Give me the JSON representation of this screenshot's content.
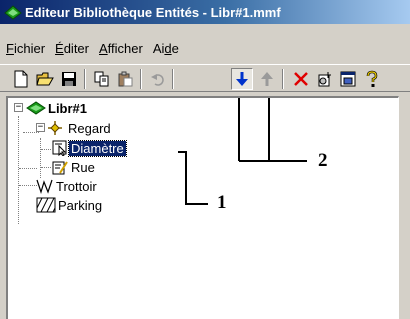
{
  "window": {
    "title": "Editeur Bibliothèque Entités - Libr#1.mmf"
  },
  "menu": [
    {
      "underline": "F",
      "rest": "ichier"
    },
    {
      "underline": "É",
      "rest": "diter"
    },
    {
      "underline": "A",
      "rest": "fficher"
    },
    {
      "pre": "Ai",
      "underline": "d",
      "rest": "e"
    }
  ],
  "toolbar": {
    "buttons": [
      "new-icon",
      "open-icon",
      "save-icon",
      "copy-icon",
      "paste-icon",
      "undo-icon",
      "move-down-icon",
      "move-up-icon",
      "delete-icon",
      "add-node-icon",
      "properties-icon",
      "help-icon"
    ],
    "pressed": "move-down-icon"
  },
  "tree": {
    "root": {
      "label": "Libr#1",
      "expander": "−"
    },
    "regard": {
      "label": "Regard",
      "expander": "−"
    },
    "diametre": {
      "label": "Diamètre"
    },
    "rue": {
      "label": "Rue"
    },
    "trottoir": {
      "label": "Trottoir"
    },
    "parking": {
      "label": "Parking"
    }
  },
  "callouts": {
    "one": "1",
    "two": "2"
  },
  "colors": {
    "titlebar_start": "#0a246a",
    "selection": "#0a246a",
    "delete": "#e00000",
    "arrow_active": "#0033cc"
  }
}
